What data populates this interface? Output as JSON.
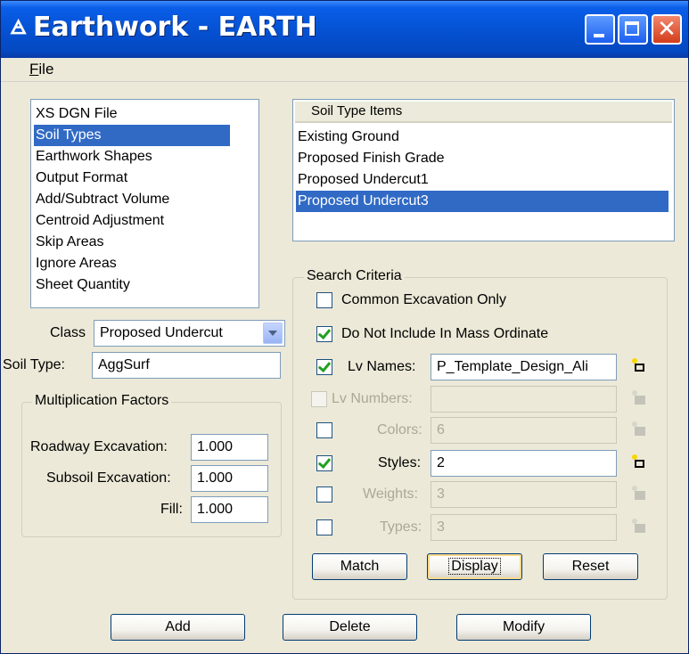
{
  "window": {
    "title": "Earthwork - EARTH",
    "app_icon": "🜁",
    "close_glyph": "✕"
  },
  "menu": {
    "file_ul": "F",
    "file_rest": "ile"
  },
  "categories": {
    "items": [
      "XS DGN File",
      "Soil Types",
      "Earthwork Shapes",
      "Output Format",
      "Add/Subtract Volume",
      "Centroid Adjustment",
      "Skip Areas",
      "Ignore Areas",
      "Sheet Quantity"
    ],
    "selected_index": 1
  },
  "soil_items": {
    "header": "Soil Type Items",
    "items": [
      "Existing Ground",
      "Proposed Finish Grade",
      "Proposed Undercut1",
      "Proposed Undercut3"
    ],
    "selected_index": 3
  },
  "class": {
    "label": "Class",
    "value": "Proposed Undercut"
  },
  "soil_type": {
    "label": "Soil Type:",
    "value": "AggSurf"
  },
  "mult": {
    "title": "Multiplication Factors",
    "roadway_label": "Roadway Excavation:",
    "roadway_value": "1.000",
    "subsoil_label": "Subsoil Excavation:",
    "subsoil_value": "1.000",
    "fill_label": "Fill:",
    "fill_value": "1.000"
  },
  "search": {
    "title": "Search Criteria",
    "common_label": "Common Excavation Only",
    "common_checked": false,
    "mass_label": "Do Not Include In Mass Ordinate",
    "mass_checked": true,
    "lv_names_label": "Lv Names:",
    "lv_names_value": "P_Template_Design_Ali",
    "lv_names_checked": true,
    "lv_numbers_label": "Lv Numbers:",
    "lv_numbers_value": "",
    "lv_numbers_checked": false,
    "colors_label": "Colors:",
    "colors_value": "6",
    "colors_checked": false,
    "styles_label": "Styles:",
    "styles_value": "2",
    "styles_checked": true,
    "weights_label": "Weights:",
    "weights_value": "3",
    "weights_checked": false,
    "types_label": "Types:",
    "types_value": "3",
    "types_checked": false,
    "match_label": "Match",
    "display_label": "Display",
    "reset_label": "Reset"
  },
  "actions": {
    "add_label": "Add",
    "delete_label": "Delete",
    "modify_label": "Modify"
  }
}
